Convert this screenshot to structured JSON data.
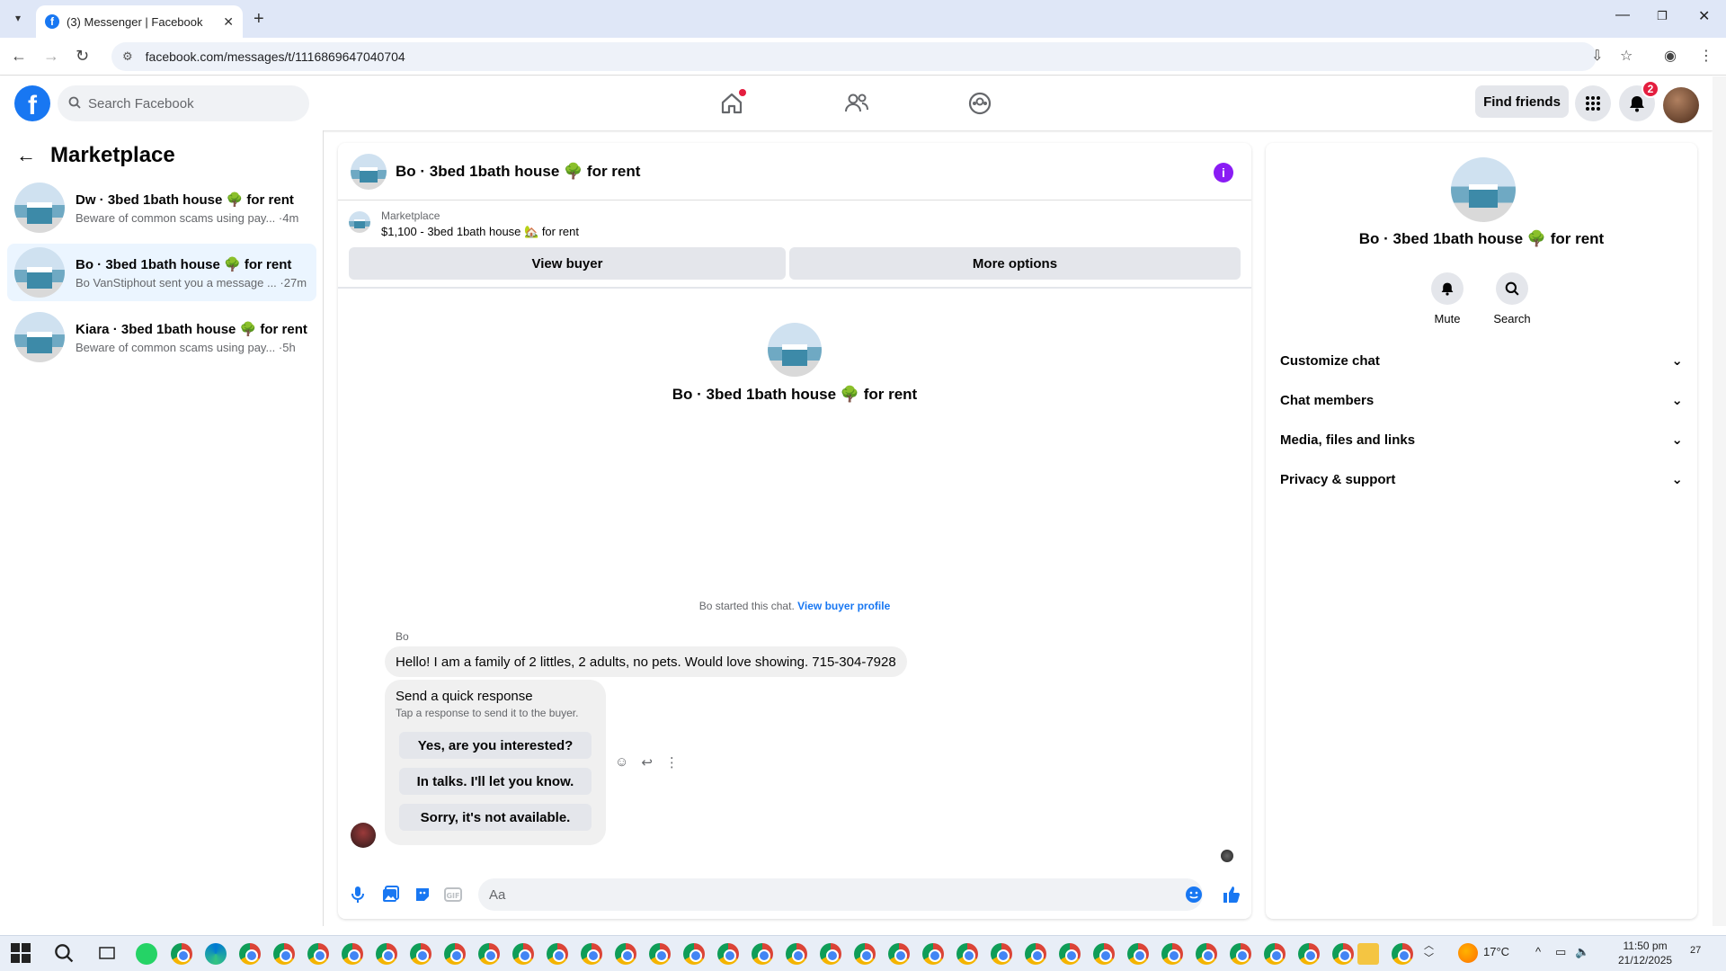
{
  "browser": {
    "tab_title": "(3) Messenger | Facebook",
    "url": "facebook.com/messages/t/1116869647040704"
  },
  "fb_header": {
    "search_placeholder": "Search Facebook",
    "find_friends": "Find friends",
    "notification_count": "2"
  },
  "left": {
    "title": "Marketplace",
    "conversations": [
      {
        "name": "Dw · 3bed 1bath house 🌳 for rent",
        "preview": "Beware of common scams using pay... ·4m",
        "active": false
      },
      {
        "name": "Bo · 3bed 1bath house 🌳 for rent",
        "preview": "Bo VanStiphout sent you a message ... ·27m",
        "active": true
      },
      {
        "name": "Kiara · 3bed 1bath house 🌳 for rent",
        "preview": "Beware of common scams using pay... ·5h",
        "active": false
      }
    ]
  },
  "chat": {
    "title": "Bo · 3bed 1bath house 🌳 for rent",
    "marketplace_label": "Marketplace",
    "listing": "$1,100 - 3bed 1bath house 🏡 for rent",
    "view_buyer": "View buyer",
    "more_options": "More options",
    "profile_title": "Bo · 3bed 1bath house 🌳 for rent",
    "started_text": "Bo started this chat.",
    "view_buyer_profile": "View buyer profile",
    "sender": "Bo",
    "message": "Hello! I am a family of 2 littles, 2 adults, no pets. Would love showing. 715-304-7928",
    "quick_title": "Send a quick response",
    "quick_sub": "Tap a response to send it to the buyer.",
    "quick_options": [
      "Yes, are you interested?",
      "In talks. I'll let you know.",
      "Sorry, it's not available."
    ],
    "composer_placeholder": "Aa"
  },
  "right": {
    "title": "Bo · 3bed 1bath house 🌳 for rent",
    "mute": "Mute",
    "search": "Search",
    "sections": [
      "Customize chat",
      "Chat members",
      "Media, files and links",
      "Privacy & support"
    ]
  },
  "taskbar": {
    "temperature": "17°C",
    "time": "11:50 pm",
    "date": "21/12/2025",
    "notif": "27"
  },
  "colors": {
    "brand": "#1877f2",
    "info": "#8a1cf4",
    "badge": "#e41e3f"
  }
}
